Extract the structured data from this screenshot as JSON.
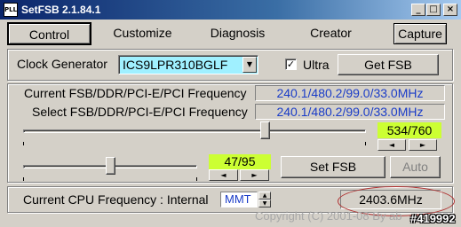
{
  "window": {
    "icon_text": "PLL",
    "title": "SetFSB 2.1.84.1",
    "minimize_glyph": "_",
    "maximize_glyph": "□",
    "close_glyph": "×"
  },
  "tabs": [
    {
      "label": "Control"
    },
    {
      "label": "Customize"
    },
    {
      "label": "Diagnosis"
    },
    {
      "label": "Creator"
    },
    {
      "label": "Capture"
    }
  ],
  "clock": {
    "label": "Clock Generator",
    "value": "ICS9LPR310BGLF",
    "ultra_label": "Ultra",
    "ultra_checked": "✓",
    "get_fsb_label": "Get FSB"
  },
  "frequencies": {
    "current_label": "Current FSB/DDR/PCI-E/PCI Frequency",
    "current_value": "240.1/480.2/99.0/33.0MHz",
    "select_label": "Select FSB/DDR/PCI-E/PCI Frequency",
    "select_value": "240.1/480.2/99.0/33.0MHz"
  },
  "fsb_slider": {
    "position_fraction": 0.713,
    "counter": "534/760"
  },
  "pcie_slider": {
    "position_fraction": 0.5,
    "counter": "47/95"
  },
  "buttons": {
    "set_fsb": "Set FSB",
    "auto": "Auto"
  },
  "cpu": {
    "label": "Current CPU Frequency : Internal",
    "mode": "MMT",
    "value": "2403.6MHz"
  },
  "footer": {
    "copyright": "Copyright (C) 2001-08 By ab",
    "watermark": "#419992"
  },
  "glyphs": {
    "down": "▼",
    "left": "◄",
    "right": "►",
    "up_small": "▲",
    "down_small": "▼"
  }
}
